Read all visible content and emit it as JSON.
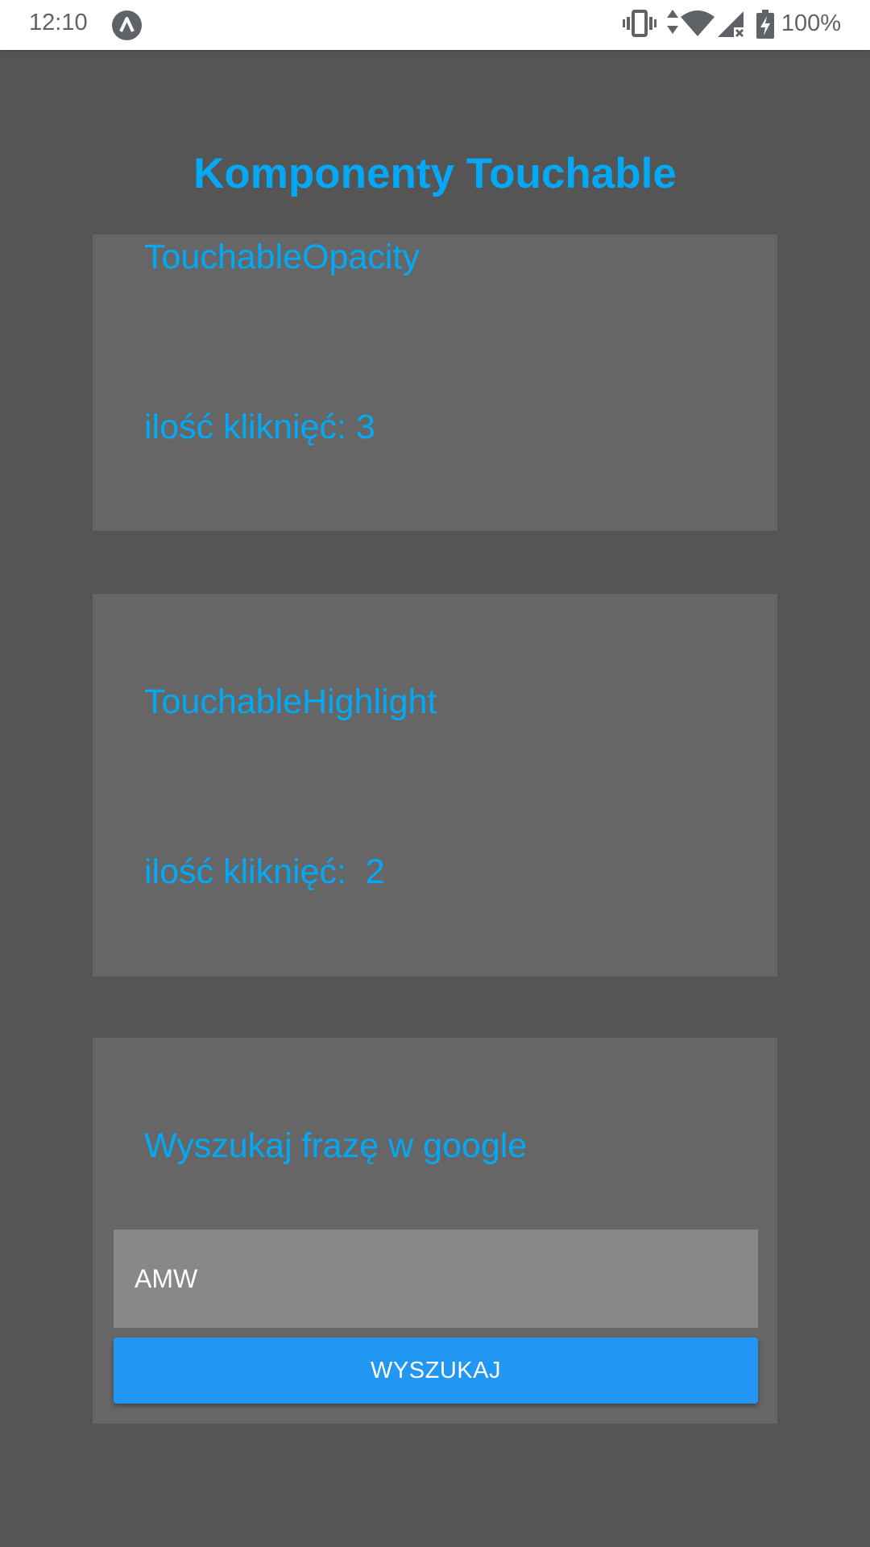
{
  "status_bar": {
    "time": "12:10",
    "app_icon": "expo-caret-icon",
    "icons": [
      "vibrate-icon",
      "data-arrows-icon",
      "wifi-icon",
      "signal-off-icon",
      "battery-charging-icon"
    ],
    "battery": "100%"
  },
  "header": {
    "title": "Komponenty Touchable"
  },
  "opacity_card": {
    "label": "TouchableOpacity",
    "clicks": "ilość kliknięć: 3"
  },
  "highlight_card": {
    "label": "TouchableHighlight",
    "clicks": "ilość kliknięć:  2"
  },
  "search_card": {
    "label": "Wyszukaj frazę w google",
    "input_value": "AMW",
    "button_label": "WYSZUKAJ"
  },
  "colors": {
    "background": "#555555",
    "card": "#666666",
    "accent": "#03a9f4",
    "button": "#2196f3",
    "input": "#888888"
  }
}
